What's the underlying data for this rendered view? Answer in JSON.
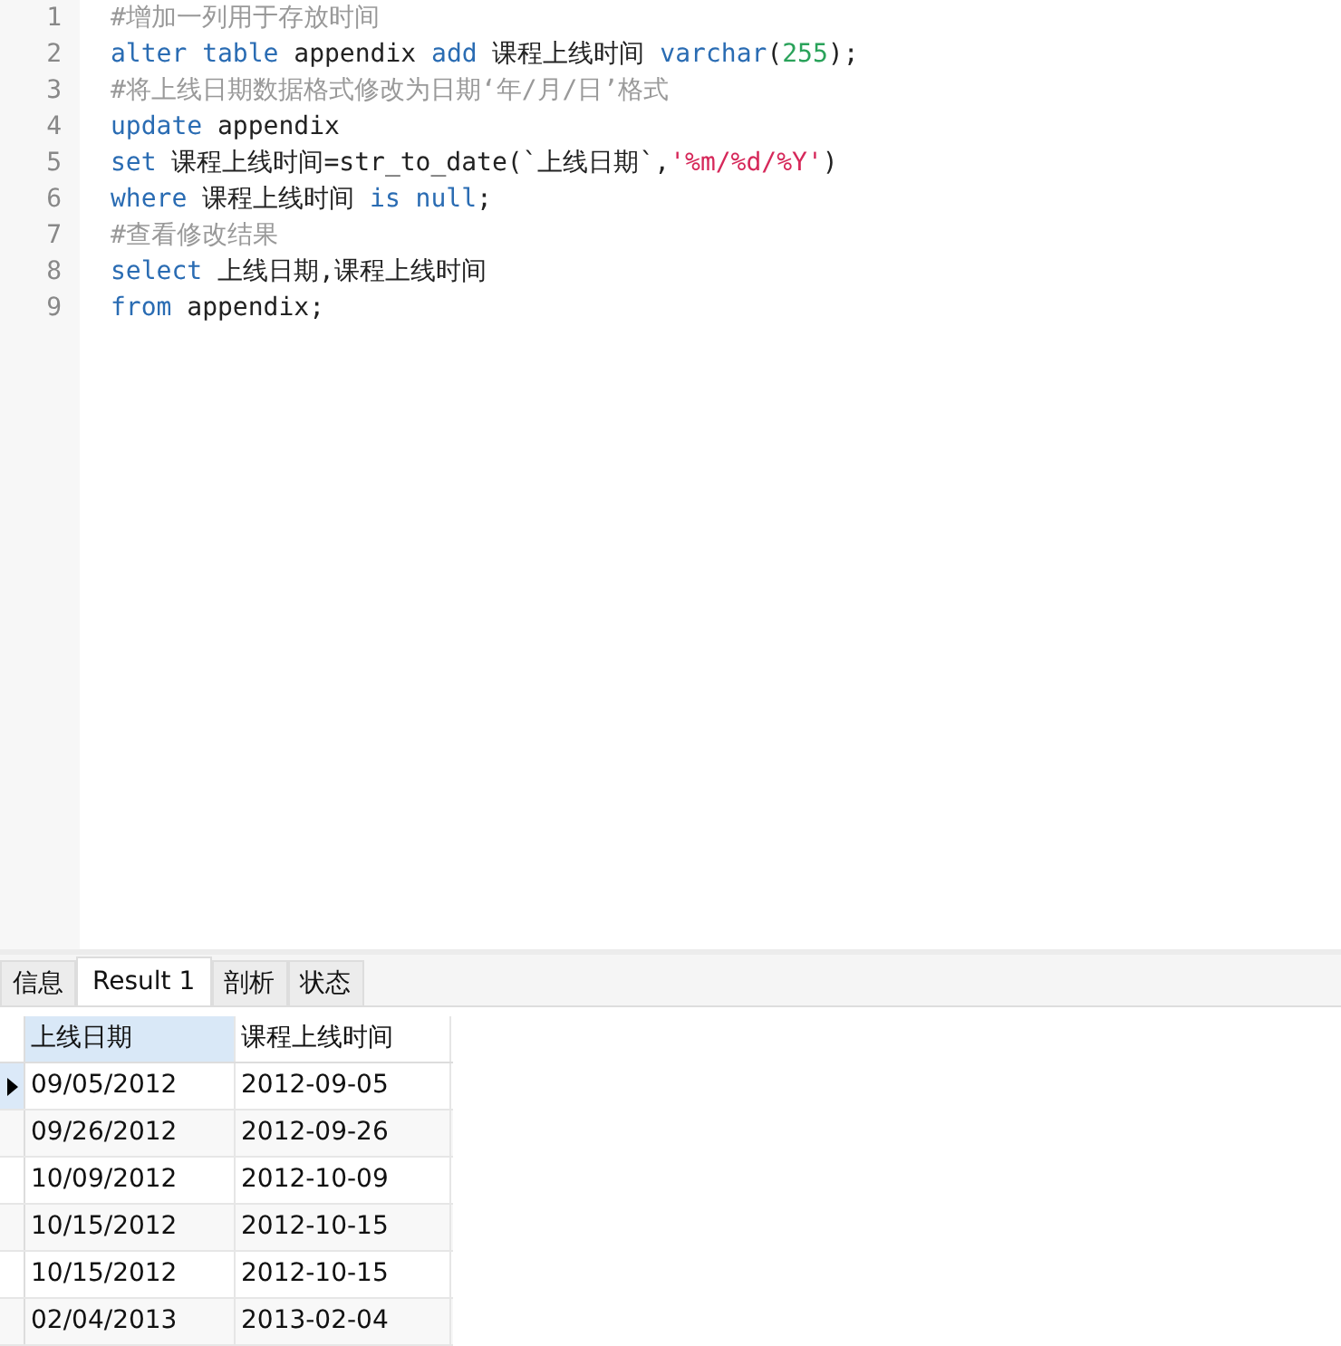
{
  "editor": {
    "lines": [
      {
        "number": "1",
        "tokens": [
          {
            "kind": "comment",
            "text": "#增加一列用于存放时间"
          }
        ]
      },
      {
        "number": "2",
        "tokens": [
          {
            "kind": "keyword",
            "text": "alter table"
          },
          {
            "kind": "plain",
            "text": " appendix "
          },
          {
            "kind": "keyword",
            "text": "add"
          },
          {
            "kind": "plain",
            "text": " 课程上线时间 "
          },
          {
            "kind": "keyword",
            "text": "varchar"
          },
          {
            "kind": "plain",
            "text": "("
          },
          {
            "kind": "number",
            "text": "255"
          },
          {
            "kind": "plain",
            "text": ");"
          }
        ]
      },
      {
        "number": "3",
        "tokens": [
          {
            "kind": "comment",
            "text": "#将上线日期数据格式修改为日期‘年/月/日’格式"
          }
        ]
      },
      {
        "number": "4",
        "tokens": [
          {
            "kind": "keyword",
            "text": "update"
          },
          {
            "kind": "plain",
            "text": " appendix"
          }
        ]
      },
      {
        "number": "5",
        "tokens": [
          {
            "kind": "keyword",
            "text": "set"
          },
          {
            "kind": "plain",
            "text": " 课程上线时间=str_to_date(`上线日期`,"
          },
          {
            "kind": "string",
            "text": "'%m/%d/%Y'"
          },
          {
            "kind": "plain",
            "text": ")"
          }
        ]
      },
      {
        "number": "6",
        "tokens": [
          {
            "kind": "keyword",
            "text": "where"
          },
          {
            "kind": "plain",
            "text": " 课程上线时间 "
          },
          {
            "kind": "keyword",
            "text": "is null"
          },
          {
            "kind": "plain",
            "text": ";"
          }
        ]
      },
      {
        "number": "7",
        "tokens": [
          {
            "kind": "comment",
            "text": "#查看修改结果"
          }
        ]
      },
      {
        "number": "8",
        "tokens": [
          {
            "kind": "keyword",
            "text": "select"
          },
          {
            "kind": "plain",
            "text": " 上线日期,课程上线时间"
          }
        ]
      },
      {
        "number": "9",
        "tokens": [
          {
            "kind": "keyword",
            "text": "from"
          },
          {
            "kind": "plain",
            "text": " appendix;"
          }
        ]
      }
    ]
  },
  "tabs": [
    {
      "label": "信息",
      "selected": false
    },
    {
      "label": "Result 1",
      "selected": true
    },
    {
      "label": "剖析",
      "selected": false
    },
    {
      "label": "状态",
      "selected": false
    }
  ],
  "table": {
    "columns": [
      {
        "label": "上线日期",
        "selected": true
      },
      {
        "label": "课程上线时间",
        "selected": false
      }
    ],
    "rows": [
      {
        "cells": [
          "09/05/2012",
          "2012-09-05"
        ],
        "selected": true
      },
      {
        "cells": [
          "09/26/2012",
          "2012-09-26"
        ],
        "selected": false
      },
      {
        "cells": [
          "10/09/2012",
          "2012-10-09"
        ],
        "selected": false
      },
      {
        "cells": [
          "10/15/2012",
          "2012-10-15"
        ],
        "selected": false
      },
      {
        "cells": [
          "10/15/2012",
          "2012-10-15"
        ],
        "selected": false
      },
      {
        "cells": [
          "02/04/2013",
          "2013-02-04"
        ],
        "selected": false
      }
    ]
  }
}
